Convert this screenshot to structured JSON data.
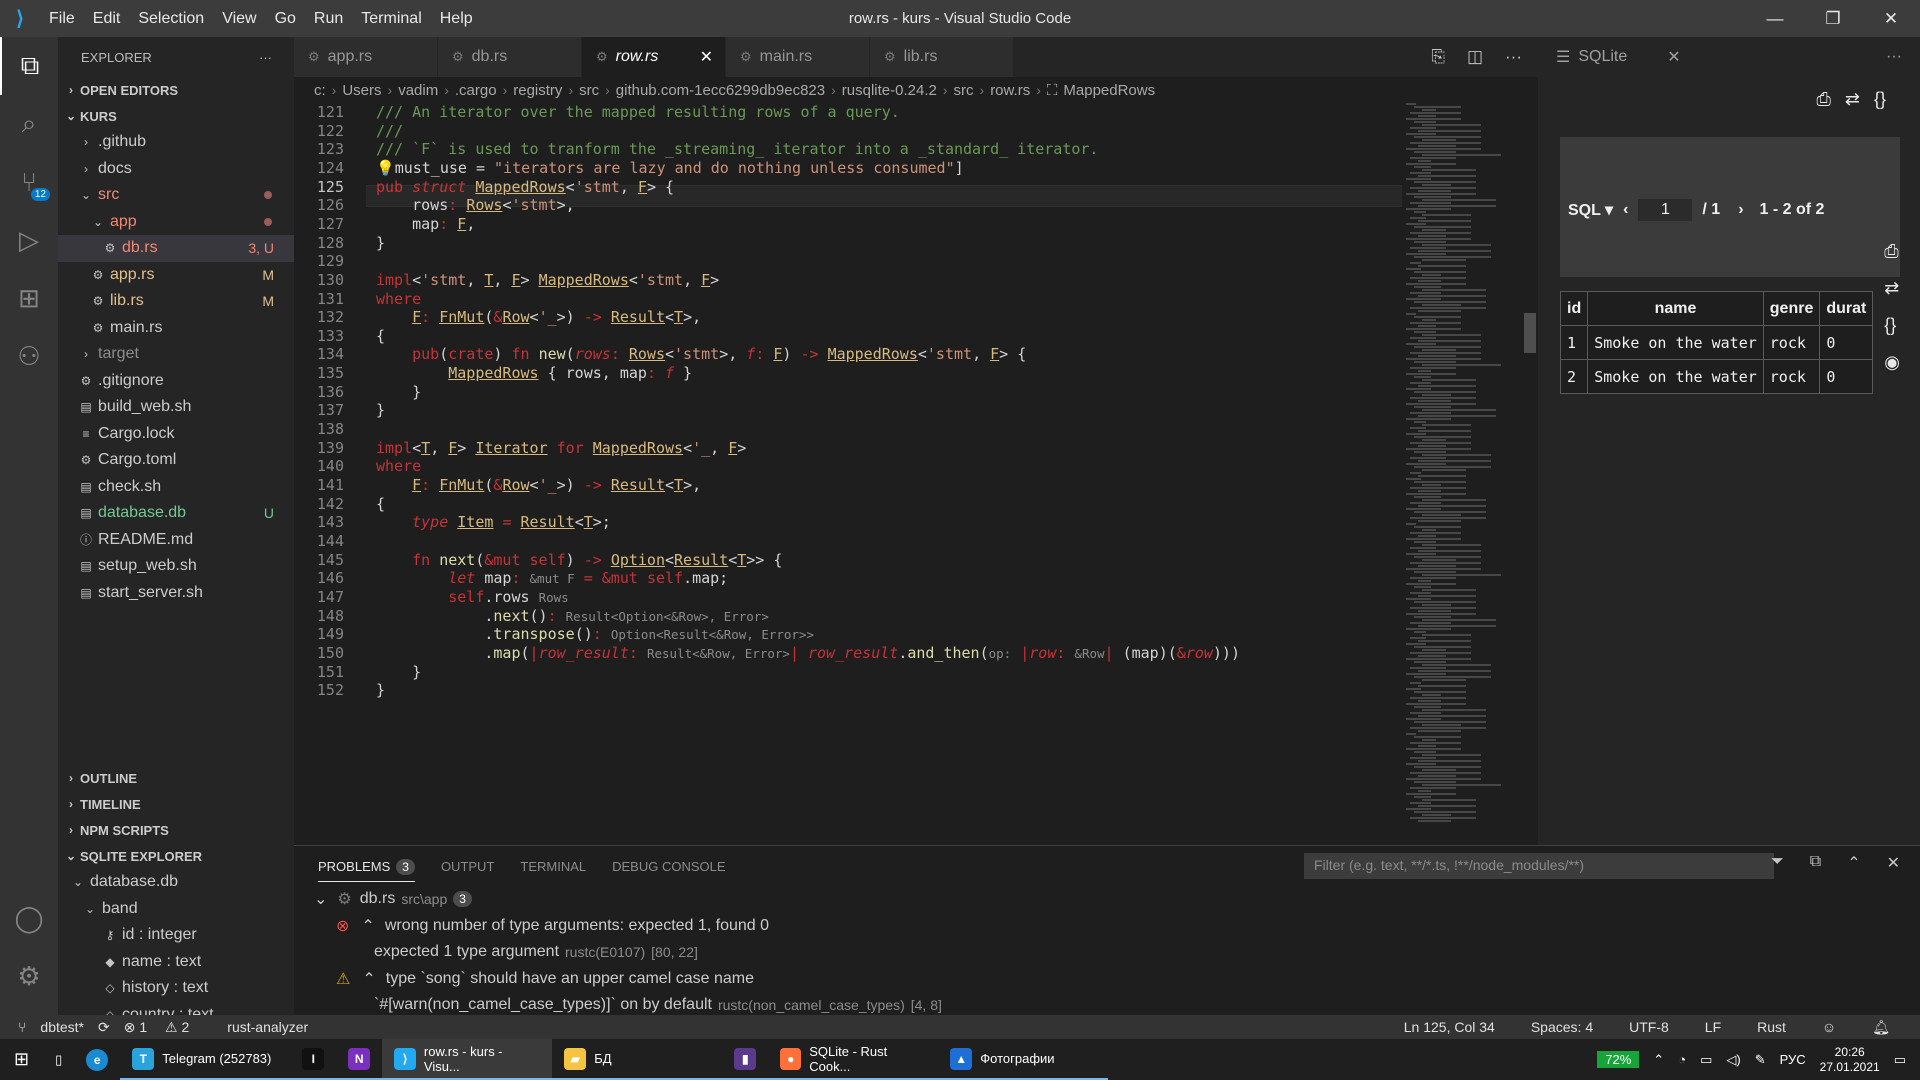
{
  "titlebar": {
    "menu": [
      "File",
      "Edit",
      "Selection",
      "View",
      "Go",
      "Run",
      "Terminal",
      "Help"
    ],
    "title": "row.rs - kurs - Visual Studio Code"
  },
  "activity": {
    "scm_badge": "12"
  },
  "sidebar": {
    "title": "EXPLORER",
    "more": "···",
    "open_editors": "OPEN EDITORS",
    "root": "KURS",
    "tree": [
      {
        "label": ".github",
        "kind": "folder",
        "depth": 1
      },
      {
        "label": "docs",
        "kind": "folder",
        "depth": 1
      },
      {
        "label": "src",
        "kind": "folder-open",
        "depth": 1,
        "dot": true,
        "color": "#f48771"
      },
      {
        "label": "app",
        "kind": "folder-open",
        "depth": 2,
        "dot": true,
        "color": "#f48771"
      },
      {
        "label": "db.rs",
        "kind": "rs",
        "depth": 3,
        "status": "3, U",
        "color": "#f48771",
        "selected": true
      },
      {
        "label": "app.rs",
        "kind": "rs",
        "depth": 2,
        "status": "M",
        "color": "#e2c08d"
      },
      {
        "label": "lib.rs",
        "kind": "rs",
        "depth": 2,
        "status": "M",
        "color": "#e2c08d"
      },
      {
        "label": "main.rs",
        "kind": "rs",
        "depth": 2
      },
      {
        "label": "target",
        "kind": "folder",
        "depth": 1,
        "color": "#8c8c8c"
      },
      {
        "label": ".gitignore",
        "kind": "gear",
        "depth": 1
      },
      {
        "label": "build_web.sh",
        "kind": "file",
        "depth": 1
      },
      {
        "label": "Cargo.lock",
        "kind": "lines",
        "depth": 1
      },
      {
        "label": "Cargo.toml",
        "kind": "gear",
        "depth": 1
      },
      {
        "label": "check.sh",
        "kind": "file",
        "depth": 1
      },
      {
        "label": "database.db",
        "kind": "file",
        "depth": 1,
        "status": "U",
        "color": "#73c991"
      },
      {
        "label": "README.md",
        "kind": "info",
        "depth": 1
      },
      {
        "label": "setup_web.sh",
        "kind": "file",
        "depth": 1
      },
      {
        "label": "start_server.sh",
        "kind": "file",
        "depth": 1
      }
    ],
    "sections": [
      "OUTLINE",
      "TIMELINE",
      "NPM SCRIPTS",
      "SQLITE EXPLORER"
    ],
    "sqlite": {
      "db": "database.db",
      "table": "band",
      "columns": [
        {
          "label": "id : integer",
          "icon": "key"
        },
        {
          "label": "name : text",
          "icon": "diamond"
        },
        {
          "label": "history : text",
          "icon": "diamond-outline"
        },
        {
          "label": "country : text",
          "icon": "diamond-outline"
        }
      ]
    }
  },
  "tabs": [
    {
      "label": "app.rs",
      "active": false
    },
    {
      "label": "db.rs",
      "active": false
    },
    {
      "label": "row.rs",
      "active": true,
      "close": "✕"
    },
    {
      "label": "main.rs",
      "active": false
    },
    {
      "label": "lib.rs",
      "active": false
    }
  ],
  "breadcrumb": [
    "c:",
    "Users",
    "vadim",
    ".cargo",
    "registry",
    "src",
    "github.com-1ecc6299db9ec823",
    "rusqlite-0.24.2",
    "src",
    "row.rs",
    "MappedRows"
  ],
  "editor": {
    "current_line": 125,
    "lines": [
      {
        "n": "121",
        "html": "<span class=\"cm\">/// An iterator over the mapped resulting rows of a query.</span>"
      },
      {
        "n": "122",
        "html": "<span class=\"cm\">///</span>"
      },
      {
        "n": "123",
        "html": "<span class=\"cm\">/// `F` is used to tranform the _streaming_ iterator into a _standard_ iterator.</span>"
      },
      {
        "n": "124",
        "html": "<span class=\"fn\">💡</span>must_use = <span class=\"str\">\"iterators are lazy and do nothing unless consumed\"</span>]"
      },
      {
        "n": "125",
        "html": "<span class=\"k\">pub</span> <span class=\"k it\">struct</span> <span class=\"ty\">MappedRows</span>&lt;<span class=\"str\">'stmt</span>, <span class=\"ty\">F</span>&gt; {"
      },
      {
        "n": "126",
        "html": "    rows<span class=\"pr\">:</span> <span class=\"ty\">Rows</span>&lt;<span class=\"str\">'stmt</span>&gt;,"
      },
      {
        "n": "127",
        "html": "    map<span class=\"pr\">:</span> <span class=\"ty\">F</span>,"
      },
      {
        "n": "128",
        "html": "}"
      },
      {
        "n": "129",
        "html": ""
      },
      {
        "n": "130",
        "html": "<span class=\"k\">impl</span>&lt;<span class=\"str\">'stmt</span>, <span class=\"ty\">T</span>, <span class=\"ty\">F</span>&gt; <span class=\"ty\">MappedRows</span>&lt;<span class=\"str\">'stmt</span>, <span class=\"ty\">F</span>&gt;"
      },
      {
        "n": "131",
        "html": "<span class=\"k\">where</span>"
      },
      {
        "n": "132",
        "html": "    <span class=\"ty\">F</span><span class=\"pr\">:</span> <span class=\"ty\">FnMut</span>(<span class=\"pr\">&amp;</span><span class=\"ty\">Row</span>&lt;<span class=\"str\">'_</span>&gt;) <span class=\"pr\">-&gt;</span> <span class=\"ty\">Result</span>&lt;<span class=\"ty\">T</span>&gt;,"
      },
      {
        "n": "133",
        "html": "{"
      },
      {
        "n": "134",
        "html": "    <span class=\"k\">pub</span>(<span class=\"k\">crate</span>) <span class=\"k\">fn</span> <span class=\"fn\">new</span>(<span class=\"pr it\">rows</span><span class=\"pr\">:</span> <span class=\"ty\">Rows</span>&lt;<span class=\"str\">'stmt</span>&gt;, <span class=\"pr it\">f</span><span class=\"pr\">:</span> <span class=\"ty\">F</span>) <span class=\"pr\">-&gt;</span> <span class=\"ty\">MappedRows</span>&lt;<span class=\"str\">'stmt</span>, <span class=\"ty\">F</span>&gt; {"
      },
      {
        "n": "135",
        "html": "        <span class=\"ty\">MappedRows</span> { rows, map<span class=\"pr\">:</span> <span class=\"pr it\">f</span> }"
      },
      {
        "n": "136",
        "html": "    }"
      },
      {
        "n": "137",
        "html": "}"
      },
      {
        "n": "138",
        "html": ""
      },
      {
        "n": "139",
        "html": "<span class=\"k\">impl</span>&lt;<span class=\"ty\">T</span>, <span class=\"ty\">F</span>&gt; <span class=\"ty\">Iterator</span> <span class=\"k\">for</span> <span class=\"ty\">MappedRows</span>&lt;<span class=\"str\">'_</span>, <span class=\"ty\">F</span>&gt;"
      },
      {
        "n": "140",
        "html": "<span class=\"k\">where</span>"
      },
      {
        "n": "141",
        "html": "    <span class=\"ty\">F</span><span class=\"pr\">:</span> <span class=\"ty\">FnMut</span>(<span class=\"pr\">&amp;</span><span class=\"ty\">Row</span>&lt;<span class=\"str\">'_</span>&gt;) <span class=\"pr\">-&gt;</span> <span class=\"ty\">Result</span>&lt;<span class=\"ty\">T</span>&gt;,"
      },
      {
        "n": "142",
        "html": "{"
      },
      {
        "n": "143",
        "html": "    <span class=\"k it\">type</span> <span class=\"ty\">Item</span> <span class=\"pr\">=</span> <span class=\"ty\">Result</span>&lt;<span class=\"ty\">T</span>&gt;;"
      },
      {
        "n": "144",
        "html": ""
      },
      {
        "n": "145",
        "html": "    <span class=\"k\">fn</span> <span class=\"fn\">next</span>(<span class=\"pr\">&amp;mut</span> <span class=\"k\">self</span>) <span class=\"pr\">-&gt;</span> <span class=\"ty\">Option</span>&lt;<span class=\"ty\">Result</span>&lt;<span class=\"ty\">T</span>&gt;&gt; {"
      },
      {
        "n": "146",
        "html": "        <span class=\"k it\">let</span> map<span class=\"pr\">:</span> <span class=\"hint\">&amp;mut F</span> <span class=\"pr\">=</span> <span class=\"pr\">&amp;mut</span> <span class=\"k\">self</span>.map;"
      },
      {
        "n": "147",
        "html": "        <span class=\"k\">self</span>.rows <span class=\"hint\">Rows</span>"
      },
      {
        "n": "148",
        "html": "            .<span class=\"fn\">next</span>()<span class=\"pr\">:</span> <span class=\"hint\">Result&lt;Option&lt;&amp;Row&gt;, Error&gt;</span>"
      },
      {
        "n": "149",
        "html": "            .<span class=\"fn\">transpose</span>()<span class=\"pr\">:</span> <span class=\"hint\">Option&lt;Result&lt;&amp;Row, Error&gt;&gt;</span>"
      },
      {
        "n": "150",
        "html": "            .<span class=\"fn\">map</span>(<span class=\"pr\">|</span><span class=\"pr it\">row_result</span><span class=\"pr\">:</span> <span class=\"hint\">Result&lt;&amp;Row, Error&gt;</span><span class=\"pr\">|</span> <span class=\"pr it\">row_result</span>.<span class=\"fn\">and_then</span>(<span class=\"hint\">op:</span> <span class=\"pr\">|</span><span class=\"pr it\">row</span><span class=\"pr\">:</span> <span class=\"hint\">&amp;Row</span><span class=\"pr\">|</span> (map)(<span class=\"pr\">&amp;</span><span class=\"pr it\">row</span>)))"
      },
      {
        "n": "151",
        "html": "    }"
      },
      {
        "n": "152",
        "html": "}"
      }
    ]
  },
  "panel": {
    "tabs": [
      {
        "label": "PROBLEMS",
        "count": "3",
        "active": true
      },
      {
        "label": "OUTPUT"
      },
      {
        "label": "TERMINAL"
      },
      {
        "label": "DEBUG CONSOLE"
      }
    ],
    "filter_placeholder": "Filter (e.g. text, **/*.ts, !**/node_modules/**)",
    "file": "db.rs",
    "file_path": "src\\app",
    "file_count": "3",
    "problems": [
      {
        "severity": "error",
        "message": "wrong number of type arguments: expected 1, found 0"
      },
      {
        "severity": "detail",
        "message": "expected 1 type argument",
        "source": "rustc(E0107)",
        "loc": "[80, 22]"
      },
      {
        "severity": "warning",
        "message": "type `song` should have an upper camel case name"
      },
      {
        "severity": "detail",
        "message": "`#[warn(non_camel_case_types)]` on by default",
        "source": "rustc(non_camel_case_types)",
        "loc": "[4, 8]"
      }
    ]
  },
  "sqlite_panel": {
    "tab": "SQLite",
    "sql_label": "SQL ▾",
    "page": "1",
    "page_total": "/ 1",
    "range": "1 - 2 of 2",
    "columns": [
      "id",
      "name",
      "genre",
      "durat"
    ],
    "rows": [
      [
        "1",
        "Smoke on the water",
        "rock",
        "0"
      ],
      [
        "2",
        "Smoke on the water",
        "rock",
        "0"
      ]
    ]
  },
  "statusbar": {
    "branch": "dbtest*",
    "errors": "1",
    "warnings": "2",
    "analyzer": "rust-analyzer",
    "position": "Ln 125, Col 34",
    "spaces": "Spaces: 4",
    "encoding": "UTF-8",
    "eol": "LF",
    "language": "Rust"
  },
  "taskbar": {
    "items": [
      {
        "label": "Telegram (252783)",
        "icon": "T",
        "color": "#2aa3dd"
      },
      {
        "label": "",
        "icon": "I",
        "color": "#111111"
      },
      {
        "label": "",
        "icon": "N",
        "color": "#7b2fbe"
      },
      {
        "label": "row.rs - kurs - Visu...",
        "icon": "⟩",
        "color": "#23a9f2",
        "active": true
      },
      {
        "label": "БД",
        "icon": "▰",
        "color": "#f5c542"
      },
      {
        "label": "",
        "icon": "▮",
        "color": "#5b3a8c"
      },
      {
        "label": "SQLite - Rust Cook...",
        "icon": "●",
        "color": "#ff7139"
      },
      {
        "label": "Фотографии",
        "icon": "▲",
        "color": "#1d6fd6"
      }
    ],
    "battery": "72%",
    "lang": "РУС",
    "time": "20:26",
    "date": "27.01.2021"
  },
  "colors": {
    "accent": "#007acc",
    "tab_active_bg": "#1e1e1e",
    "statusbar_bg": "#333333"
  }
}
